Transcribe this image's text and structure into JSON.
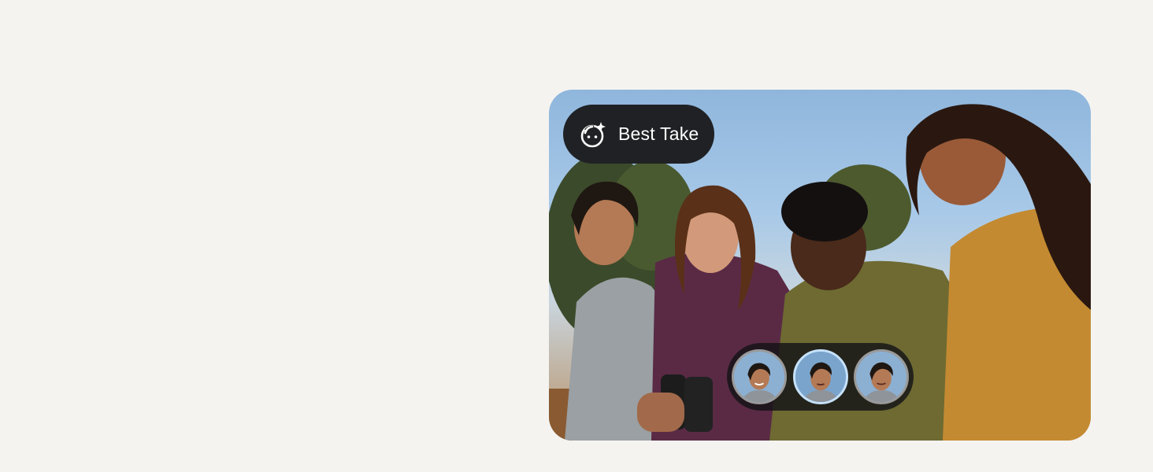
{
  "badge": {
    "label": "Best Take",
    "icon": "face-sparkle-icon"
  },
  "photo": {
    "icon": "group-photo"
  },
  "face_picker": {
    "options": [
      {
        "name": "face-option-1",
        "selected": false
      },
      {
        "name": "face-option-2",
        "selected": true
      },
      {
        "name": "face-option-3",
        "selected": false
      }
    ]
  },
  "colors": {
    "page_background": "#f4f3f0",
    "badge_background": "#202124",
    "badge_text": "#ffffff",
    "selected_ring": "#c6e2fb"
  }
}
